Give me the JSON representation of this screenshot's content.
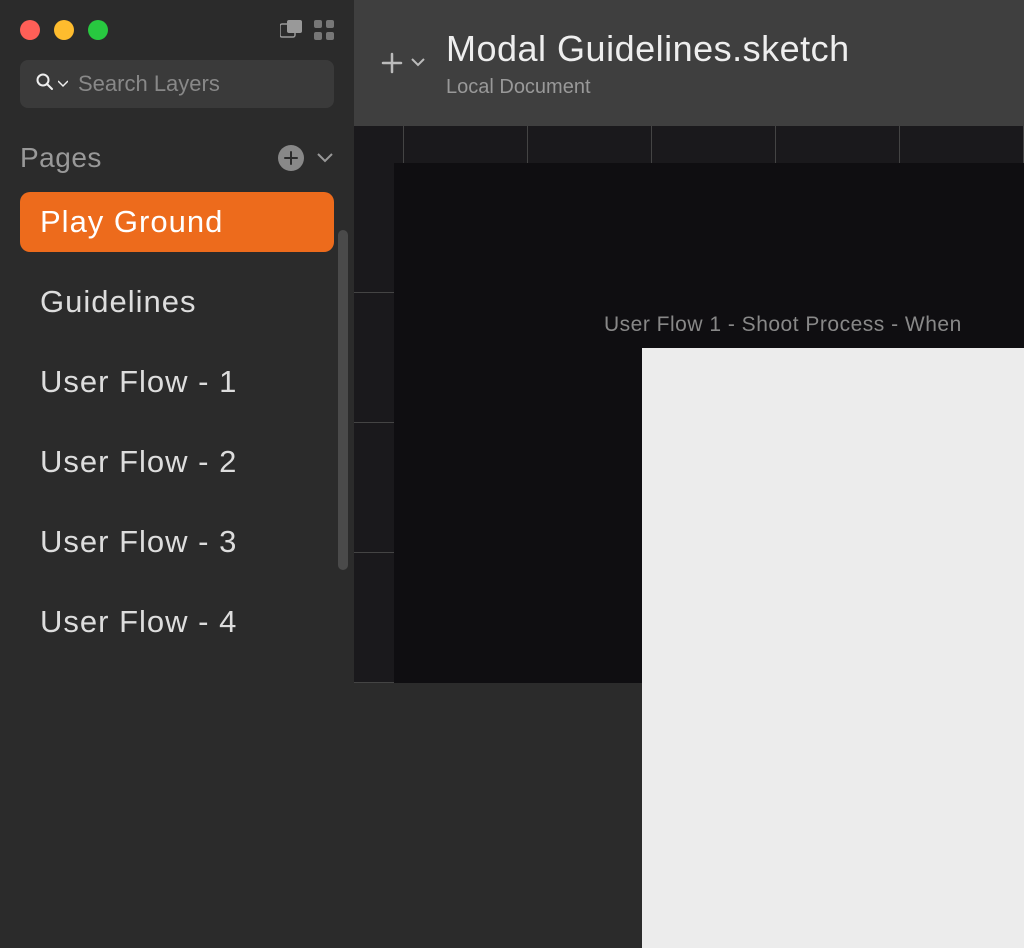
{
  "sidebar": {
    "search_placeholder": "Search Layers",
    "pages_label": "Pages",
    "pages": [
      {
        "label": "Play Ground",
        "active": true
      },
      {
        "label": "Guidelines",
        "active": false
      },
      {
        "label": "User Flow - 1",
        "active": false
      },
      {
        "label": "User Flow - 2",
        "active": false
      },
      {
        "label": "User Flow - 3",
        "active": false
      },
      {
        "label": "User Flow - 4",
        "active": false
      }
    ]
  },
  "header": {
    "title": "Modal Guidelines.sketch",
    "subtitle": "Local Document"
  },
  "canvas": {
    "artboard_label": "User Flow 1 - Shoot Process - When"
  },
  "colors": {
    "accent": "#ed6b1c",
    "sidebar_bg": "#2b2b2b",
    "header_bg": "#3f3f3f",
    "canvas_bg": "#0f0e11"
  }
}
